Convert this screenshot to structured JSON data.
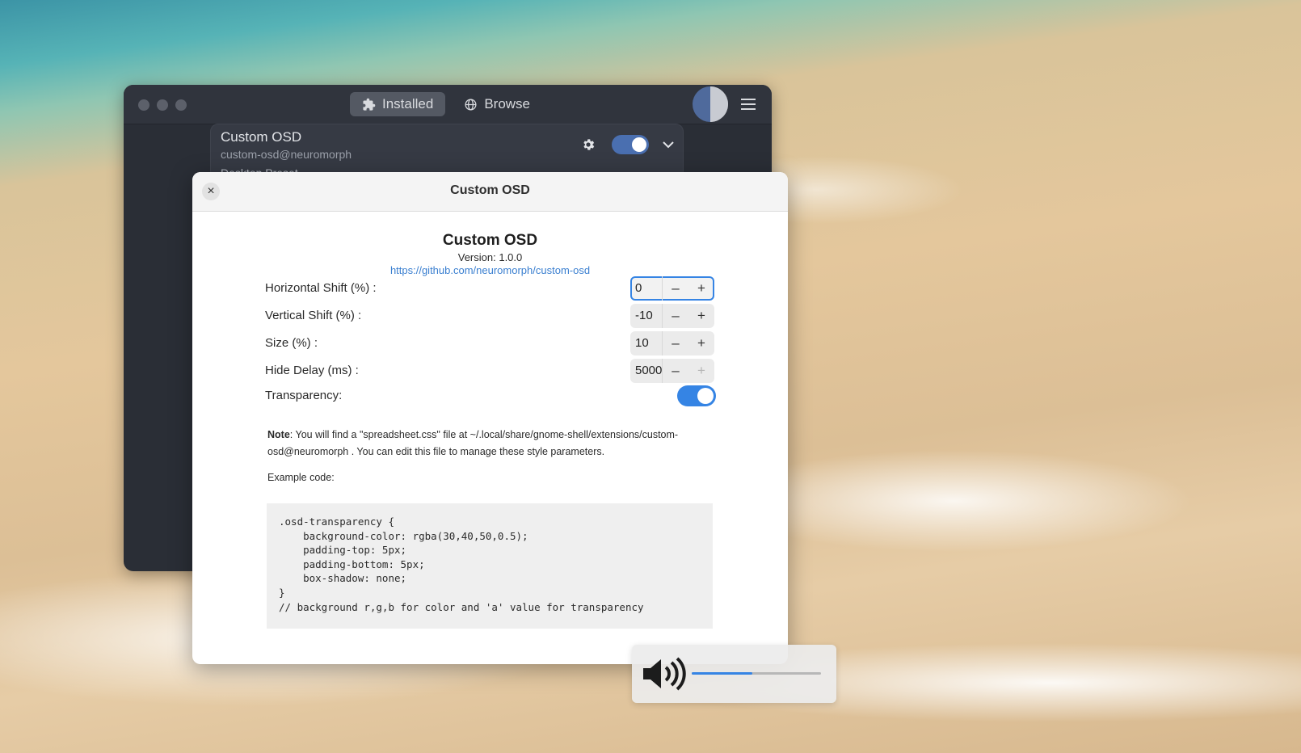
{
  "main_window": {
    "tabs": [
      {
        "label": "Installed",
        "icon": "puzzle-icon",
        "active": true
      },
      {
        "label": "Browse",
        "icon": "globe-icon",
        "active": false
      }
    ],
    "extension": {
      "name": "Custom OSD",
      "uuid": "custom-osd@neuromorph",
      "partial_text": "Desktop Preset",
      "enabled": true
    }
  },
  "dialog": {
    "title": "Custom OSD",
    "close_label": "×",
    "about": {
      "name": "Custom OSD",
      "version": "Version: 1.0.0",
      "link": "https://github.com/neuromorph/custom-osd"
    },
    "prefs": [
      {
        "label": "Horizontal Shift (%) :",
        "value": "0"
      },
      {
        "label": "Vertical Shift (%) :",
        "value": "-10"
      },
      {
        "label": "Size (%) :",
        "value": "10"
      },
      {
        "label": "Hide Delay (ms) :",
        "value": "5000"
      }
    ],
    "minus": "–",
    "plus": "+",
    "transparency": {
      "label": "Transparency:",
      "enabled": true
    },
    "note": {
      "bold": "Note",
      "text": ": You will find a \"spreadsheet.css\" file at ~/.local/share/gnome-shell/extensions/custom-osd@neuromorph . You can edit this file to manage these style parameters.",
      "example_label": "Example code:",
      "code": ".osd-transparency {\n    background-color: rgba(30,40,50,0.5);\n    padding-top: 5px;\n    padding-bottom: 5px;\n    box-shadow: none;\n}\n// background r,g,b for color and 'a' value for transparency"
    }
  },
  "osd": {
    "icon": "volume-high-icon",
    "volume_fraction": 0.47
  },
  "colors": {
    "accent": "#3584e4",
    "window_bg": "#2a2e36",
    "switch_dark": "#4a6fb0"
  }
}
